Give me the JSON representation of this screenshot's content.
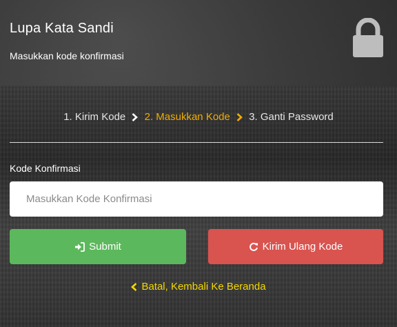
{
  "header": {
    "title": "Lupa Kata Sandi",
    "subtitle": "Masukkan kode konfirmasi",
    "icon": "lock-icon"
  },
  "steps": {
    "step1": "1. Kirim Kode",
    "step2": "2. Masukkan Kode",
    "step3": "3. Ganti Password",
    "active_step": 2,
    "active_color": "#f0ad00"
  },
  "form": {
    "label": "Kode Konfirmasi",
    "input_placeholder": "Masukkan Kode Konfirmasi",
    "input_value": "",
    "submit_label": "Submit",
    "submit_icon": "sign-in-icon",
    "submit_color": "#5cb85c",
    "resend_label": "Kirim Ulang Kode",
    "resend_icon": "refresh-icon",
    "resend_color": "#d9534f"
  },
  "footer": {
    "back_label": "Batal, Kembali Ke Beranda",
    "back_icon": "chevron-left-icon",
    "link_color": "#f5d800"
  }
}
